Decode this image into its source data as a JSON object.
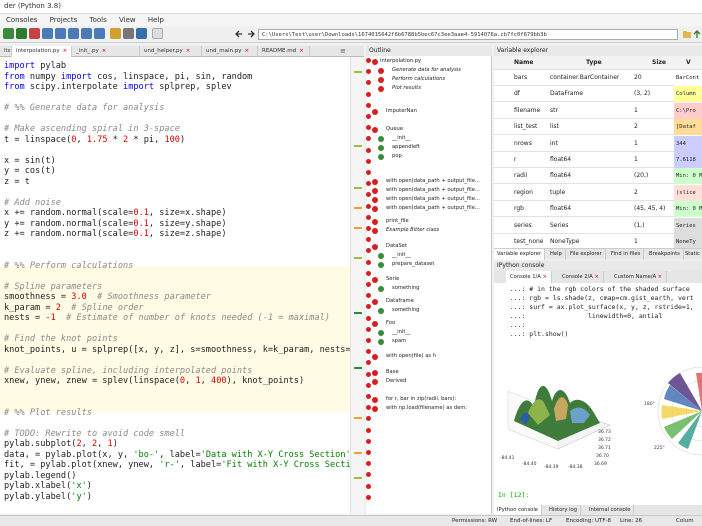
{
  "window": {
    "title": "der (Python 3.8)"
  },
  "menu": [
    "Consoles",
    "Projects",
    "Tools",
    "View",
    "Help"
  ],
  "toolbar": {
    "path": "C:\\Users\\Test\\user\\Downloads\\1674015642f6b6788b5bec67c3ee3aae4-5914076a.cb7fc0f679bb3b"
  },
  "editor": {
    "tabs": [
      "lts",
      "interpolation.py",
      "_init_.py",
      "und_helper.py",
      "und_main.py",
      "README.md"
    ],
    "active_tab": 1,
    "lines": [
      [
        [
          "kw",
          "import"
        ],
        [
          "t",
          " pylab"
        ]
      ],
      [
        [
          "kw",
          "from"
        ],
        [
          "t",
          " numpy "
        ],
        [
          "kw",
          "import"
        ],
        [
          "t",
          " cos, linspace, pi, sin, random"
        ]
      ],
      [
        [
          "kw",
          "from"
        ],
        [
          "t",
          " scipy.interpolate "
        ],
        [
          "kw",
          "import"
        ],
        [
          "t",
          " splprep, splev"
        ]
      ],
      [],
      [
        [
          "cm",
          "# %% Generate data for analysis"
        ]
      ],
      [],
      [
        [
          "cm",
          "# Make ascending spiral in 3-space"
        ]
      ],
      [
        [
          "t",
          "t = linspace("
        ],
        [
          "num",
          "0"
        ],
        [
          "t",
          ", "
        ],
        [
          "num",
          "1.75"
        ],
        [
          "t",
          " * "
        ],
        [
          "num",
          "2"
        ],
        [
          "t",
          " * pi, "
        ],
        [
          "num",
          "100"
        ],
        [
          "t",
          ")"
        ]
      ],
      [],
      [
        [
          "t",
          "x = sin(t)"
        ]
      ],
      [
        [
          "t",
          "y = cos(t)"
        ]
      ],
      [
        [
          "t",
          "z = t"
        ]
      ],
      [],
      [
        [
          "cm",
          "# Add noise"
        ]
      ],
      [
        [
          "t",
          "x += random.normal(scale="
        ],
        [
          "num",
          "0.1"
        ],
        [
          "t",
          ", size=x.shape)"
        ]
      ],
      [
        [
          "t",
          "y += random.normal(scale="
        ],
        [
          "num",
          "0.1"
        ],
        [
          "t",
          ", size=y.shape)"
        ]
      ],
      [
        [
          "t",
          "z += random.normal(scale="
        ],
        [
          "num",
          "0.1"
        ],
        [
          "t",
          ", size=z.shape)"
        ]
      ],
      [],
      [],
      [
        [
          "cm",
          "# %% Perform calculations"
        ]
      ],
      [],
      [
        [
          "cm",
          "# Spline parameters"
        ]
      ],
      [
        [
          "t",
          "smoothness = "
        ],
        [
          "num",
          "3.0"
        ],
        [
          "cm",
          "  # Smoothness parameter"
        ]
      ],
      [
        [
          "t",
          "k_param = "
        ],
        [
          "num",
          "2"
        ],
        [
          "cm",
          "  # Spline order"
        ]
      ],
      [
        [
          "t",
          "nests = "
        ],
        [
          "num",
          "-1"
        ],
        [
          "cm",
          "  # Estimate of number of knots needed (-1 = maximal)"
        ]
      ],
      [],
      [
        [
          "cm",
          "# Find the knot points"
        ]
      ],
      [
        [
          "t",
          "knot_points, u = splprep([x, y, z], s=smoothness, k=k_param, nests="
        ],
        [
          "num",
          "-1"
        ],
        [
          "t",
          ")"
        ]
      ],
      [],
      [
        [
          "cm",
          "# Evaluate spline, including interpolated points"
        ]
      ],
      [
        [
          "t",
          "xnew, ynew, znew = splev(linspace("
        ],
        [
          "num",
          "0"
        ],
        [
          "t",
          ", "
        ],
        [
          "num",
          "1"
        ],
        [
          "t",
          ", "
        ],
        [
          "num",
          "400"
        ],
        [
          "t",
          "), knot_points)"
        ]
      ],
      [],
      [],
      [
        [
          "cm",
          "# %% Plot results"
        ]
      ],
      [],
      [
        [
          "cm",
          "# TODO: Rewrite to avoid code smell"
        ]
      ],
      [
        [
          "t",
          "pylab.subplot("
        ],
        [
          "num",
          "2"
        ],
        [
          "t",
          ", "
        ],
        [
          "num",
          "2"
        ],
        [
          "t",
          ", "
        ],
        [
          "num",
          "1"
        ],
        [
          "t",
          ")"
        ]
      ],
      [
        [
          "t",
          "data, = pylab.plot(x, y, "
        ],
        [
          "str",
          "'bo-'"
        ],
        [
          "t",
          ", label="
        ],
        [
          "str",
          "'Data with X-Y Cross Section'"
        ],
        [
          "t",
          ")"
        ]
      ],
      [
        [
          "t",
          "fit, = pylab.plot(xnew, ynew, "
        ],
        [
          "str",
          "'r-'"
        ],
        [
          "t",
          ", label="
        ],
        [
          "str",
          "'Fit with X-Y Cross Section'"
        ],
        [
          "t",
          ")"
        ]
      ],
      [
        [
          "t",
          "pylab.legend()"
        ]
      ],
      [
        [
          "t",
          "pylab.xlabel("
        ],
        [
          "str",
          "'x'"
        ],
        [
          "t",
          ")"
        ]
      ],
      [
        [
          "t",
          "pylab.ylabel("
        ],
        [
          "str",
          "'y'"
        ],
        [
          "t",
          ")"
        ]
      ]
    ]
  },
  "outline": {
    "title": "Outline",
    "items": [
      {
        "label": "interpolation.py",
        "indent": 0,
        "italic": false
      },
      {
        "label": "Generate data for analysis",
        "indent": 2,
        "italic": true
      },
      {
        "label": "Perform calculations",
        "indent": 2,
        "italic": true
      },
      {
        "label": "Plot results",
        "indent": 2,
        "italic": true
      },
      {
        "label": "ImputerNan",
        "indent": 1,
        "italic": false
      },
      {
        "label": "Queue",
        "indent": 1,
        "italic": false
      },
      {
        "label": "__init__",
        "indent": 2,
        "italic": false
      },
      {
        "label": "appendleft",
        "indent": 2,
        "italic": false
      },
      {
        "label": "pop",
        "indent": 2,
        "italic": false
      },
      {
        "label": "with open(data_path + output_file...",
        "indent": 1,
        "italic": false
      },
      {
        "label": "with open(data_path + output_file...",
        "indent": 1,
        "italic": false
      },
      {
        "label": "with open(data_path + output_file...",
        "indent": 1,
        "italic": false
      },
      {
        "label": "with open(data_path + output_file...",
        "indent": 1,
        "italic": false
      },
      {
        "label": "print_file",
        "indent": 1,
        "italic": false
      },
      {
        "label": "Example Bitter class",
        "indent": 1,
        "italic": true
      },
      {
        "label": "DataSet",
        "indent": 1,
        "italic": false
      },
      {
        "label": "__init__",
        "indent": 2,
        "italic": false
      },
      {
        "label": "prepare_dataset",
        "indent": 2,
        "italic": false
      },
      {
        "label": "Serie",
        "indent": 1,
        "italic": false
      },
      {
        "label": "something",
        "indent": 2,
        "italic": false
      },
      {
        "label": "Dataframe",
        "indent": 1,
        "italic": false
      },
      {
        "label": "something",
        "indent": 2,
        "italic": false
      },
      {
        "label": "Foo",
        "indent": 1,
        "italic": false
      },
      {
        "label": "__init__",
        "indent": 2,
        "italic": false
      },
      {
        "label": "spam",
        "indent": 2,
        "italic": false
      },
      {
        "label": "with open(file) as h",
        "indent": 1,
        "italic": false
      },
      {
        "label": "Base",
        "indent": 1,
        "italic": false
      },
      {
        "label": "Derived",
        "indent": 1,
        "italic": false
      },
      {
        "label": "for r, bar in zip(radii, bars):",
        "indent": 1,
        "italic": false
      },
      {
        "label": "with np.load(filename) as dem:",
        "indent": 1,
        "italic": false
      }
    ]
  },
  "variable_explorer": {
    "title": "Variable explorer",
    "headers": [
      "Name",
      "Type",
      "Size",
      "V"
    ],
    "rows": [
      {
        "name": "bars",
        "type": "container.BarContainer",
        "size": "20",
        "value": "BarCont",
        "color": "#ffffff"
      },
      {
        "name": "df",
        "type": "DataFrame",
        "size": "(3, 2)",
        "value": "Column",
        "color": "#ffff99"
      },
      {
        "name": "filename",
        "type": "str",
        "size": "1",
        "value": "C:\\Pro",
        "color": "#ffcccc"
      },
      {
        "name": "list_test",
        "type": "list",
        "size": "2",
        "value": "[Dataf",
        "color": "#ffdd99"
      },
      {
        "name": "nrows",
        "type": "int",
        "size": "1",
        "value": "344",
        "color": "#ccccff"
      },
      {
        "name": "r",
        "type": "float64",
        "size": "1",
        "value": "7.6118",
        "color": "#ccccff"
      },
      {
        "name": "radii",
        "type": "float64",
        "size": "(20,)",
        "value": "Min: 0 Max: 9",
        "color": "#ccffcc"
      },
      {
        "name": "region",
        "type": "tuple",
        "size": "2",
        "value": "(slice",
        "color": "#ffdfd8"
      },
      {
        "name": "rgb",
        "type": "float64",
        "size": "(45, 45, 4)",
        "value": "Min: 0 Max: 0",
        "color": "#ccffcc"
      },
      {
        "name": "series",
        "type": "Series",
        "size": "(1,)",
        "value": "Series",
        "color": "#dddddd"
      },
      {
        "name": "test_none",
        "type": "NoneType",
        "size": "1",
        "value": "NoneTy",
        "color": "#dddddd"
      }
    ],
    "bottom_tabs": [
      "Variable explorer",
      "Help",
      "File explorer",
      "Find in files",
      "Breakpoints",
      "Static"
    ]
  },
  "console": {
    "title": "IPython console",
    "tabs": [
      "Console 1/A",
      "Console 2/A",
      "Custom Name/A"
    ],
    "lines": [
      "   ...: # in the rgb colors of the shaded surface",
      "   ...: rgb = ls.shade(z, cmap=cm.gist_earth, vert",
      "   ...: surf = ax.plot_surface(x, y, z, rstride=1,",
      "   ...:                linewidth=0, antial",
      "   ...:",
      "   ...: plt.show()"
    ],
    "prompt": "In [12]:",
    "bottom_tabs": [
      "IPython console",
      "History log",
      "Internal console"
    ],
    "plot_ticks": {
      "x": [
        "-84.41",
        "-84.40",
        "-84.39",
        "-84.38"
      ],
      "y": [
        "36.73",
        "36.72",
        "36.71",
        "36.70",
        "36.69"
      ],
      "polar": [
        "180°",
        "225°",
        "0°",
        "45°",
        "90°"
      ]
    }
  },
  "status": {
    "permissions": "Permissions: RW",
    "eol": "End-of-lines: LF",
    "encoding": "Encoding: UTF-8",
    "line": "Line: 26",
    "col": "Colum"
  }
}
